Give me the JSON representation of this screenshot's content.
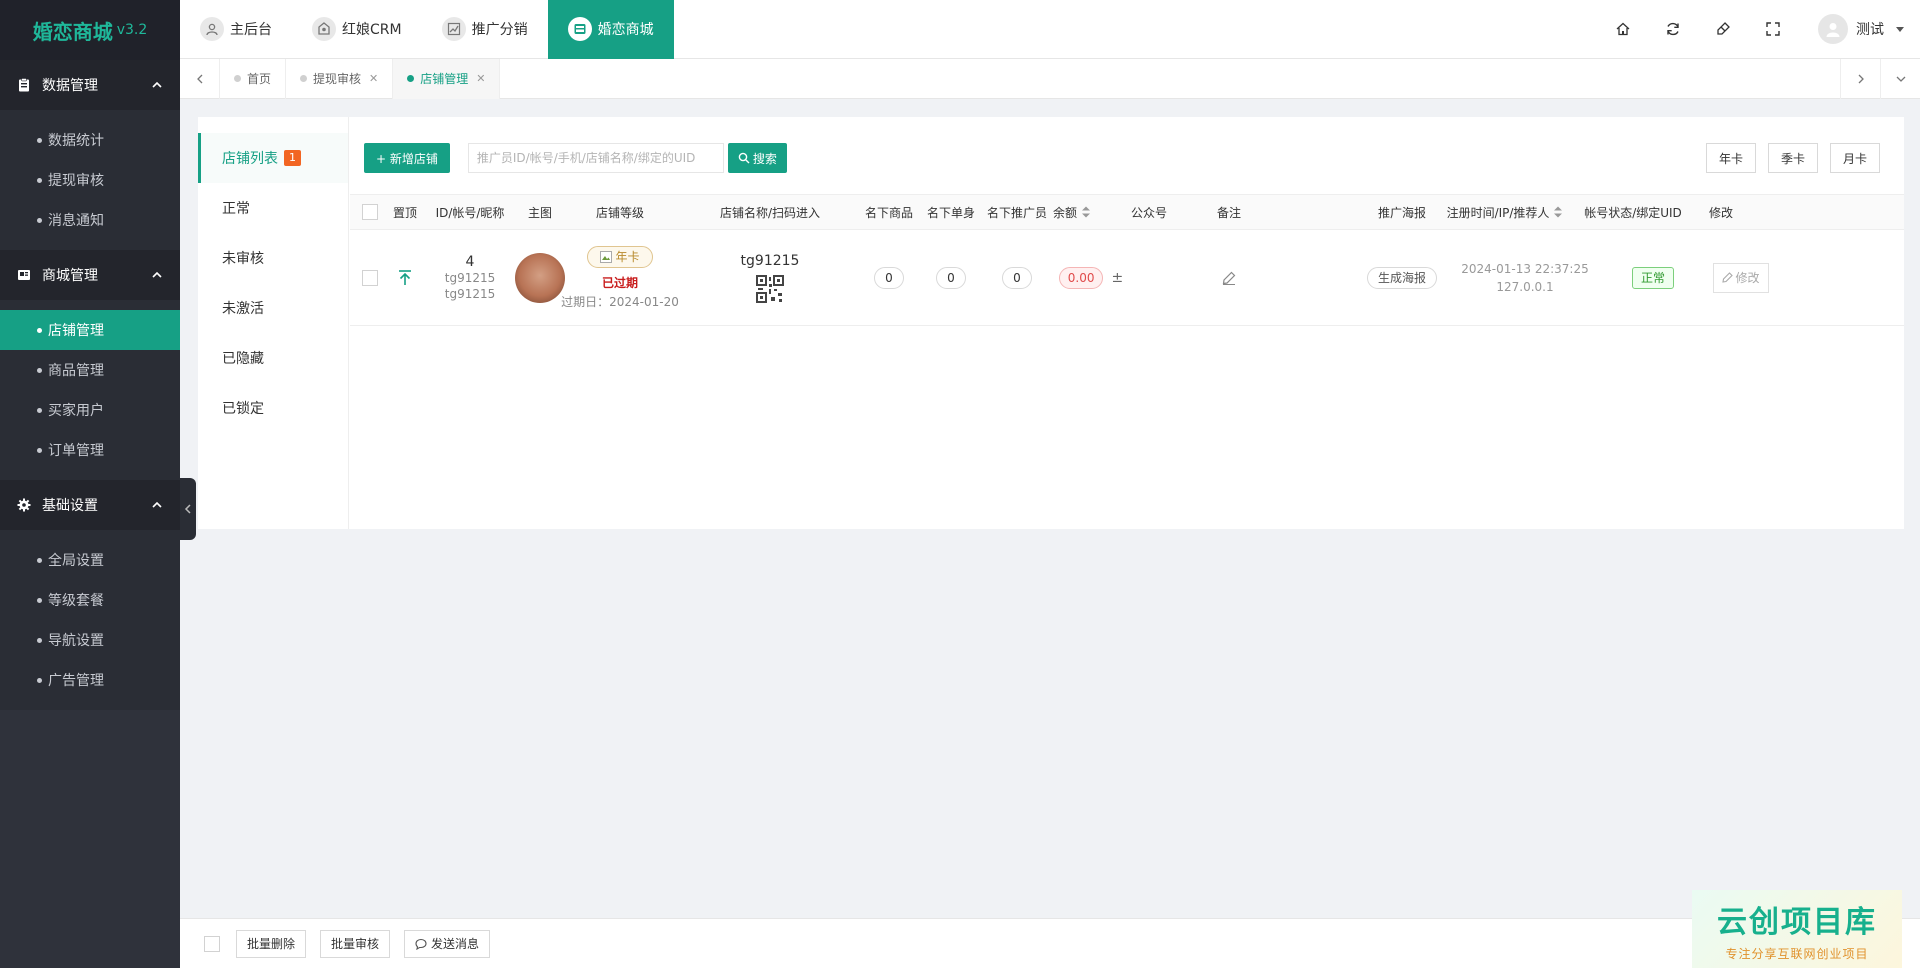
{
  "brand": {
    "name": "婚恋商城",
    "version": "v3.2",
    "color": "#16a085"
  },
  "sidebar": {
    "groups": [
      {
        "label": "数据管理",
        "icon": "clipboard-icon",
        "items": [
          {
            "label": "数据统计"
          },
          {
            "label": "提现审核"
          },
          {
            "label": "消息通知"
          }
        ]
      },
      {
        "label": "商城管理",
        "icon": "store-icon",
        "items": [
          {
            "label": "店铺管理",
            "active": true
          },
          {
            "label": "商品管理"
          },
          {
            "label": "买家用户"
          },
          {
            "label": "订单管理"
          }
        ]
      },
      {
        "label": "基础设置",
        "icon": "gear-icon",
        "items": [
          {
            "label": "全局设置"
          },
          {
            "label": "等级套餐"
          },
          {
            "label": "导航设置"
          },
          {
            "label": "广告管理"
          }
        ]
      }
    ]
  },
  "header": {
    "apps": [
      {
        "label": "主后台",
        "icon": "user-icon"
      },
      {
        "label": "红娘CRM",
        "icon": "matchmaker-icon"
      },
      {
        "label": "推广分销",
        "icon": "chart-icon"
      },
      {
        "label": "婚恋商城",
        "icon": "shop-icon",
        "active": true
      }
    ],
    "tools": [
      "home-icon",
      "refresh-icon",
      "clear-icon",
      "fullscreen-icon"
    ],
    "user": {
      "name": "测试"
    }
  },
  "tabs": [
    {
      "label": "首页",
      "closable": false
    },
    {
      "label": "提现审核",
      "closable": true
    },
    {
      "label": "店铺管理",
      "closable": true,
      "active": true
    }
  ],
  "status_nav": [
    {
      "label": "店铺列表",
      "badge": "1",
      "active": true
    },
    {
      "label": "正常"
    },
    {
      "label": "未审核"
    },
    {
      "label": "未激活"
    },
    {
      "label": "已隐藏"
    },
    {
      "label": "已锁定"
    }
  ],
  "toolbar": {
    "add_label": "+ 新增店铺",
    "search_placeholder": "推广员ID/帐号/手机/店铺名称/绑定的UID",
    "search_label": "搜索",
    "filters": [
      "年卡",
      "季卡",
      "月卡"
    ]
  },
  "table": {
    "columns": {
      "pin": "置顶",
      "id": "ID/帐号/昵称",
      "img": "主图",
      "level": "店铺等级",
      "name": "店铺名称/扫码进入",
      "goods": "名下商品",
      "singles": "名下单身",
      "promoters": "名下推广员",
      "balance": "余额",
      "mp": "公众号",
      "remark": "备注",
      "poster": "推广海报",
      "reg": "注册时间/IP/推荐人",
      "status": "帐号状态/绑定UID",
      "edit": "修改"
    },
    "rows": [
      {
        "id": "4",
        "account": "tg91215",
        "nickname": "tg91215",
        "level": "年卡",
        "level_state": "已过期",
        "expire": "过期日：2024-01-20",
        "store_name": "tg91215",
        "goods": "0",
        "singles": "0",
        "promoters": "0",
        "balance": "0.00",
        "balance_adjust": "±",
        "poster": "生成海报",
        "reg_time": "2024-01-13 22:37:25",
        "ip": "127.0.0.1",
        "status": "正常",
        "edit": "修改"
      }
    ]
  },
  "footer": {
    "batch_delete": "批量删除",
    "batch_review": "批量审核",
    "send_message": "发送消息"
  },
  "watermark": {
    "title": "云创项目库",
    "subtitle": "专注分享互联网创业项目"
  }
}
